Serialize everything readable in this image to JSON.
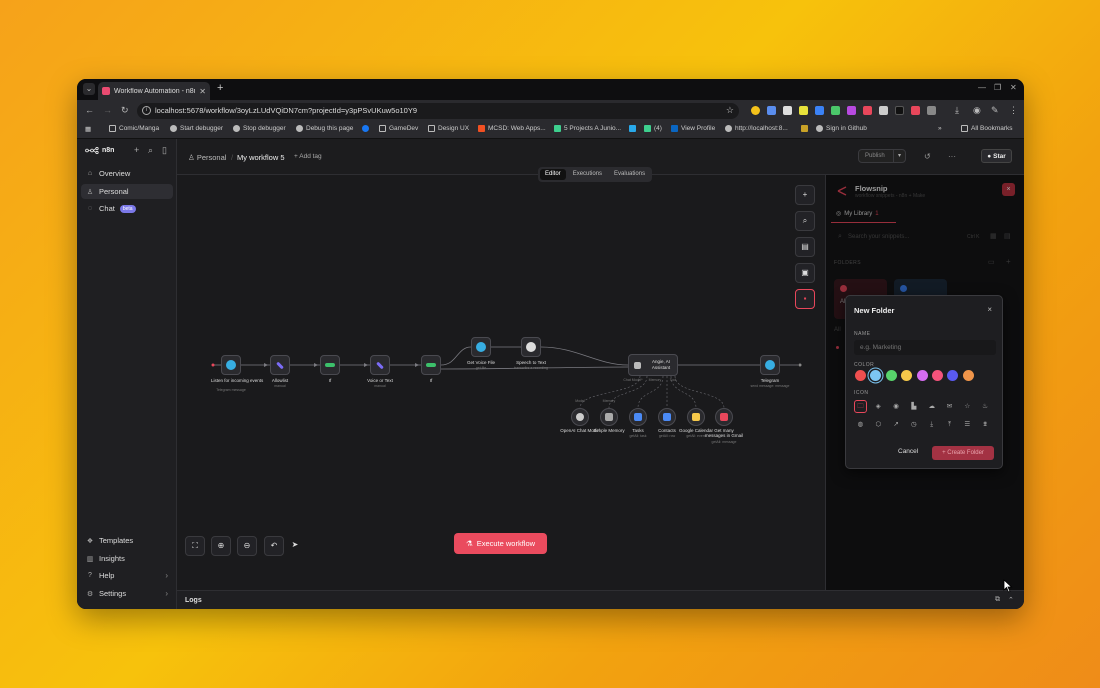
{
  "browser": {
    "tab_title": "Workflow Automation - n8n",
    "url": "localhost:5678/workflow/3oyLzLUdVQiDN7cm?projectId=y3pPSvUKuw5o10Y9",
    "bookmarks": [
      "Comic/Manga",
      "Start debugger",
      "Stop debugger",
      "Debug this page",
      "GameDev",
      "Design UX",
      "MCSD: Web Apps...",
      "5 Projects A Junio...",
      "(4)",
      "View Profile",
      "http://localhost:8...",
      "Sign in Github",
      "All Bookmarks"
    ]
  },
  "sidebar": {
    "logo": "n8n",
    "items": [
      {
        "label": "Overview",
        "icon": "home-icon"
      },
      {
        "label": "Personal",
        "icon": "user-icon"
      },
      {
        "label": "Chat",
        "icon": "chat-icon",
        "badge": "beta"
      }
    ],
    "bottom_items": [
      {
        "label": "Templates",
        "icon": "templates-icon"
      },
      {
        "label": "Insights",
        "icon": "insights-icon"
      },
      {
        "label": "Help",
        "icon": "help-icon"
      },
      {
        "label": "Settings",
        "icon": "settings-icon"
      }
    ]
  },
  "header": {
    "project": "Personal",
    "workflow_name": "My workflow 5",
    "add_tag": "+ Add tag",
    "publish": "Publish",
    "star": "Star"
  },
  "canvas": {
    "tabs": [
      "Editor",
      "Executions",
      "Evaluations"
    ],
    "execute_button": "Execute workflow",
    "nodes": [
      {
        "label": "Listen for incoming events",
        "sub": "Telegram message"
      },
      {
        "label": "Allowlist",
        "sub": "manual"
      },
      {
        "label": "If",
        "sub": ""
      },
      {
        "label": "Voice or Text",
        "sub": "manual"
      },
      {
        "label": "If",
        "sub": ""
      },
      {
        "label": "Get Voice File",
        "sub": "get file"
      },
      {
        "label": "Speech to Text",
        "sub": "transcribe a recording"
      },
      {
        "label": "Angie, AI Assistant",
        "sub": ""
      },
      {
        "label": "Telegram",
        "sub": "send message: message"
      }
    ],
    "sub_nodes": [
      {
        "label": "OpenAI Chat Model",
        "top": "Model"
      },
      {
        "label": "Simple Memory",
        "top": "Memory"
      },
      {
        "label": "Tasks",
        "sub": "getAll: task"
      },
      {
        "label": "Contacts",
        "sub": "getAll: row"
      },
      {
        "label": "Google Calendar",
        "sub": "getAll: event"
      },
      {
        "label": "Get many messages in Gmail",
        "sub": "getAll: message"
      }
    ],
    "connection_labels": [
      "Chat Model*",
      "Memory",
      "Tool"
    ]
  },
  "flowsnip": {
    "title": "Flowsnip",
    "subtitle": "workflow snippets - n8n + Make",
    "tab": "My Library",
    "tab_count": "1",
    "search_placeholder": "Search your snippets...",
    "search_shortcut": "Ctrl K",
    "folders_label": "FOLDERS",
    "all_label": "All",
    "all_snippets": "All"
  },
  "modal": {
    "title": "New Folder",
    "name_label": "NAME",
    "name_placeholder": "e.g. Marketing",
    "color_label": "COLOR",
    "icon_label": "ICON",
    "colors": [
      "#ef4f4f",
      "#7cc6f3",
      "#58d36b",
      "#f5c84a",
      "#d56cf0",
      "#f3537b",
      "#5a5af0",
      "#f0954a"
    ],
    "selected_color_index": 1,
    "icons": [
      "folder-icon",
      "tag-icon",
      "eye-icon",
      "chart-icon",
      "cloud-icon",
      "mail-icon",
      "star-icon",
      "flame-icon",
      "globe-icon",
      "box-icon",
      "trend-icon",
      "clock-icon",
      "download-icon",
      "upload-icon",
      "list-icon",
      "filter-icon"
    ],
    "cancel": "Cancel",
    "create": "+ Create Folder"
  },
  "logs": {
    "label": "Logs"
  },
  "colors": {
    "accent": "#ea4b5e",
    "bg": "#1a1a1c",
    "backdrop": "#f7b214"
  }
}
